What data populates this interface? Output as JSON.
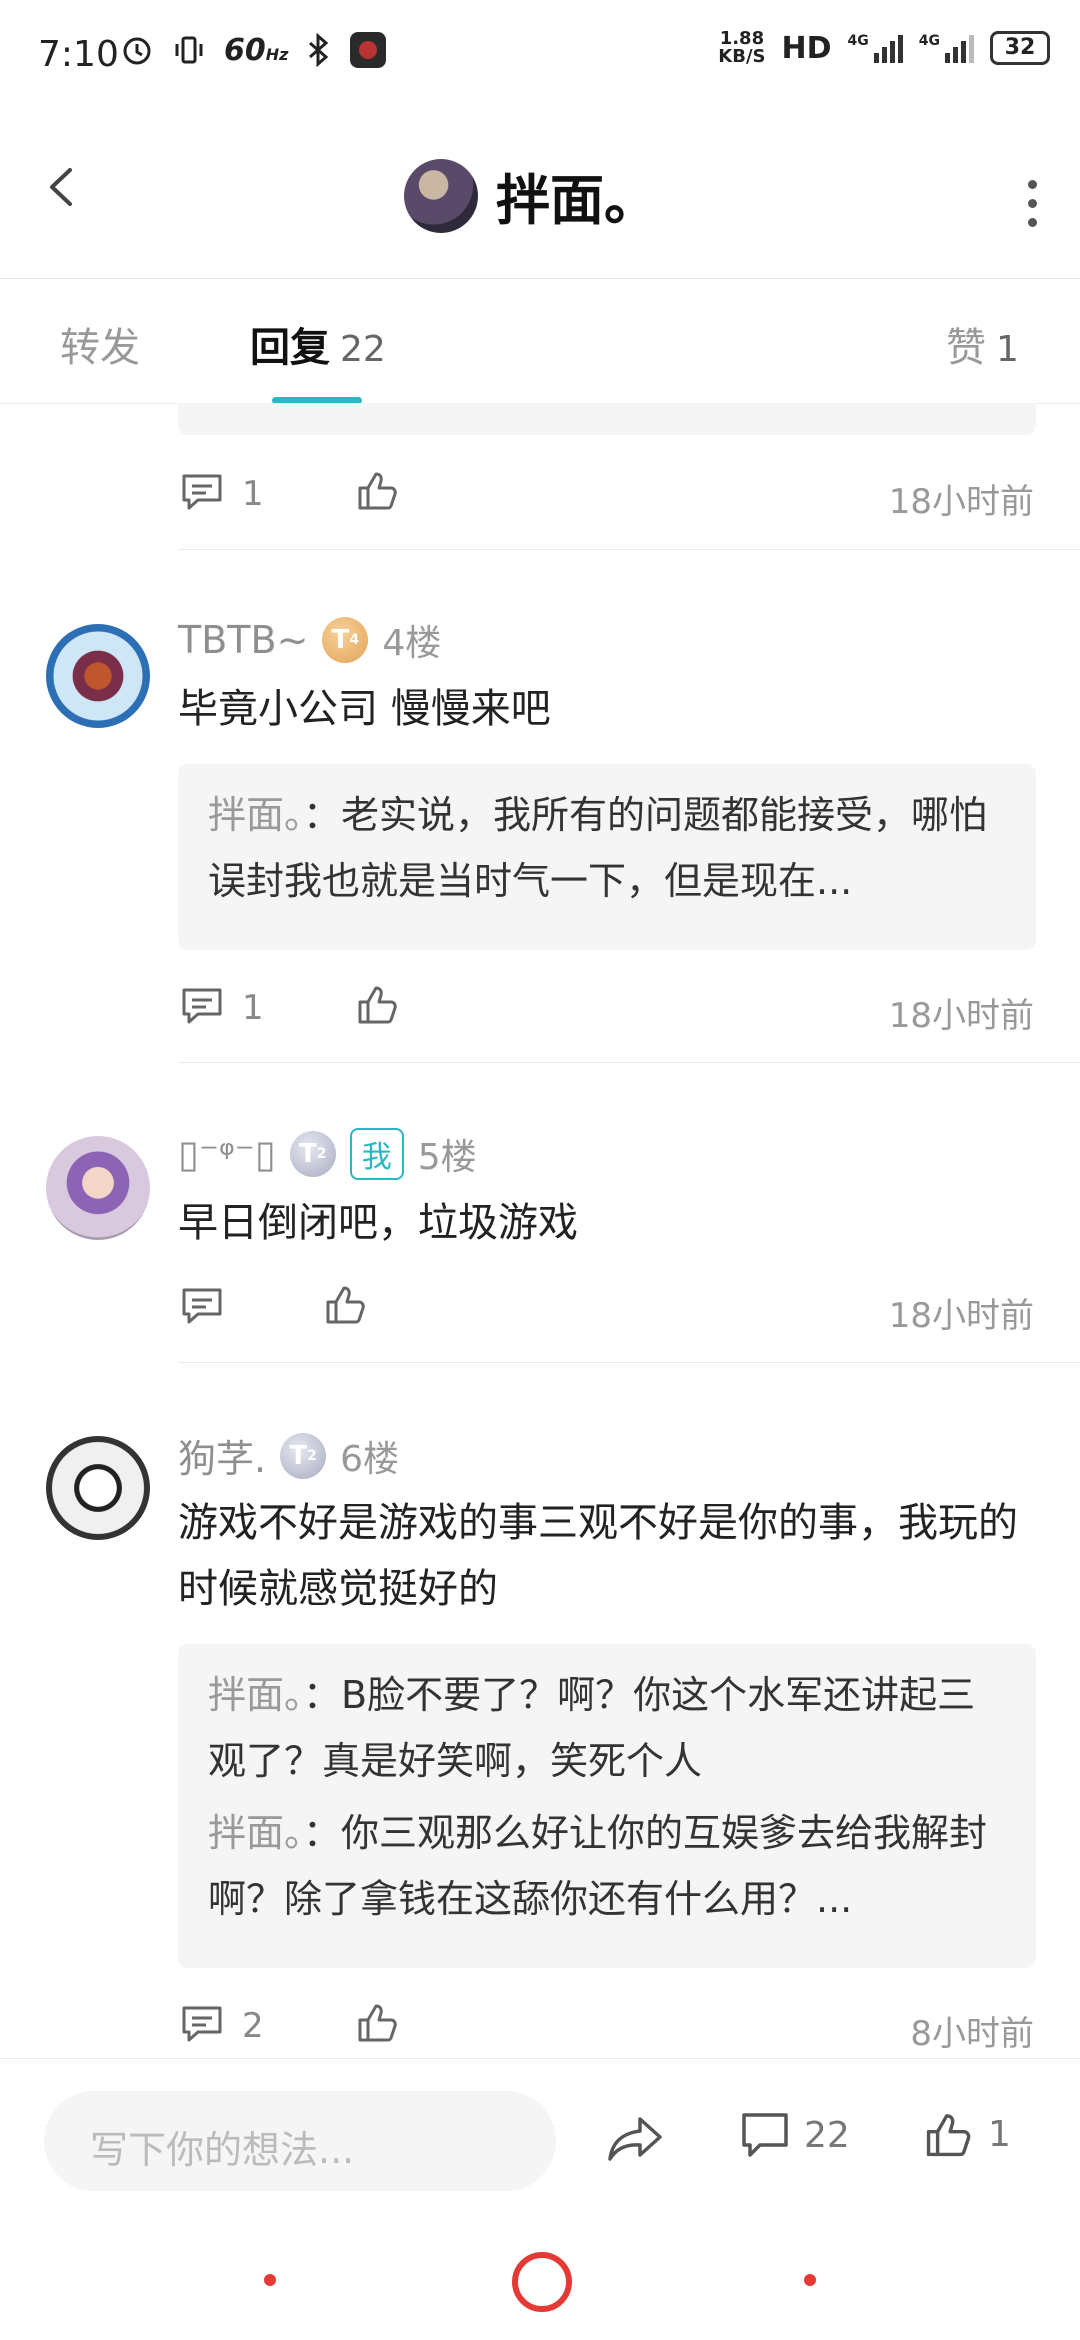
{
  "status_bar": {
    "time": "7:10",
    "refresh": "60",
    "refresh_unit": "Hz",
    "speed_value": "1.88",
    "speed_unit": "KB/S",
    "hd": "HD",
    "net1": "4G",
    "net2": "4G",
    "battery": "32"
  },
  "header": {
    "title": "拌面。"
  },
  "tabs": [
    {
      "label": "转发",
      "count": ""
    },
    {
      "label": "回复",
      "count": "22"
    },
    {
      "label": "赞",
      "count": "1"
    }
  ],
  "accent_color": "#2bb6c4",
  "top_partial": {
    "comment_count": "1",
    "time": "18小时前"
  },
  "replies": [
    {
      "user": "TBTB~",
      "badge": "T",
      "badge_level": "4",
      "floor": "4楼",
      "text": "毕竟小公司 慢慢来吧",
      "quotes": [
        {
          "user": "拌面。",
          "text": "：老实说，我所有的问题都能接受，哪怕误封我也就是当时气一下，但是现在..."
        }
      ],
      "comment_count": "1",
      "time": "18小时前"
    },
    {
      "user": "▯⁻ᵠ⁻▯",
      "badge": "T",
      "badge_level": "2",
      "me_tag": "我",
      "floor": "5楼",
      "text": "早日倒闭吧，垃圾游戏",
      "comment_count": "",
      "time": "18小时前"
    },
    {
      "user": "狗芓.",
      "badge": "T",
      "badge_level": "2",
      "floor": "6楼",
      "text": "游戏不好是游戏的事三观不好是你的事，我玩的时候就感觉挺好的",
      "quotes": [
        {
          "user": "拌面。",
          "text": "：B脸不要了？啊？你这个水军还讲起三观了？真是好笑啊，笑死个人"
        },
        {
          "user": "拌面。",
          "text": "：你三观那么好让你的互娱爹去给我解封啊？除了拿钱在这舔你还有什么用？..."
        }
      ],
      "comment_count": "2",
      "time": "8小时前"
    }
  ],
  "bottom_bar": {
    "placeholder": "写下你的想法...",
    "comment_count": "22",
    "like_count": "1"
  }
}
